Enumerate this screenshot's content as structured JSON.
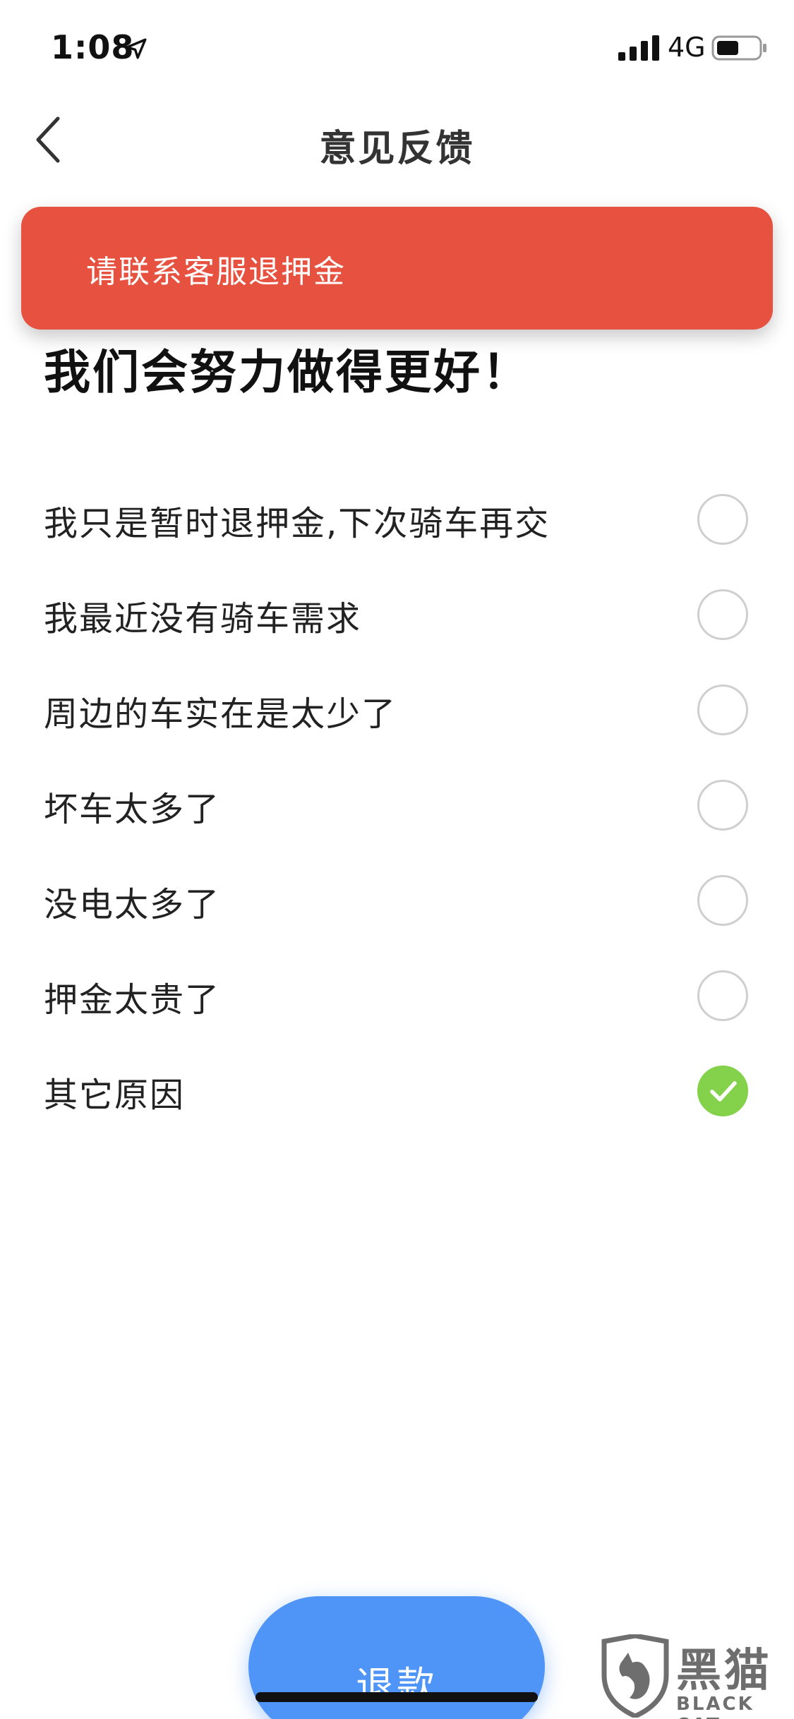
{
  "status_bar": {
    "time": "1:08",
    "network": "4G",
    "icons": [
      "location-arrow-icon",
      "cellular-signal-icon",
      "battery-icon"
    ]
  },
  "nav": {
    "title": "意见反馈",
    "back_icon": "chevron-left-icon"
  },
  "toast": {
    "message": "请联系客服退押金",
    "color": "#e7513f"
  },
  "headline": "我们会努力做得更好！",
  "reasons": [
    {
      "label": "我只是暂时退押金,下次骑车再交",
      "checked": false
    },
    {
      "label": "我最近没有骑车需求",
      "checked": false
    },
    {
      "label": "周边的车实在是太少了",
      "checked": false
    },
    {
      "label": "坏车太多了",
      "checked": false
    },
    {
      "label": "没电太多了",
      "checked": false
    },
    {
      "label": "押金太贵了",
      "checked": false
    },
    {
      "label": "其它原因",
      "checked": true
    }
  ],
  "refund_button": {
    "label": "退款",
    "color": "#4f95f7"
  },
  "check_color": "#84d14b",
  "watermark": {
    "brand_cn": "黑猫",
    "brand_en": "BLACK CAT"
  }
}
